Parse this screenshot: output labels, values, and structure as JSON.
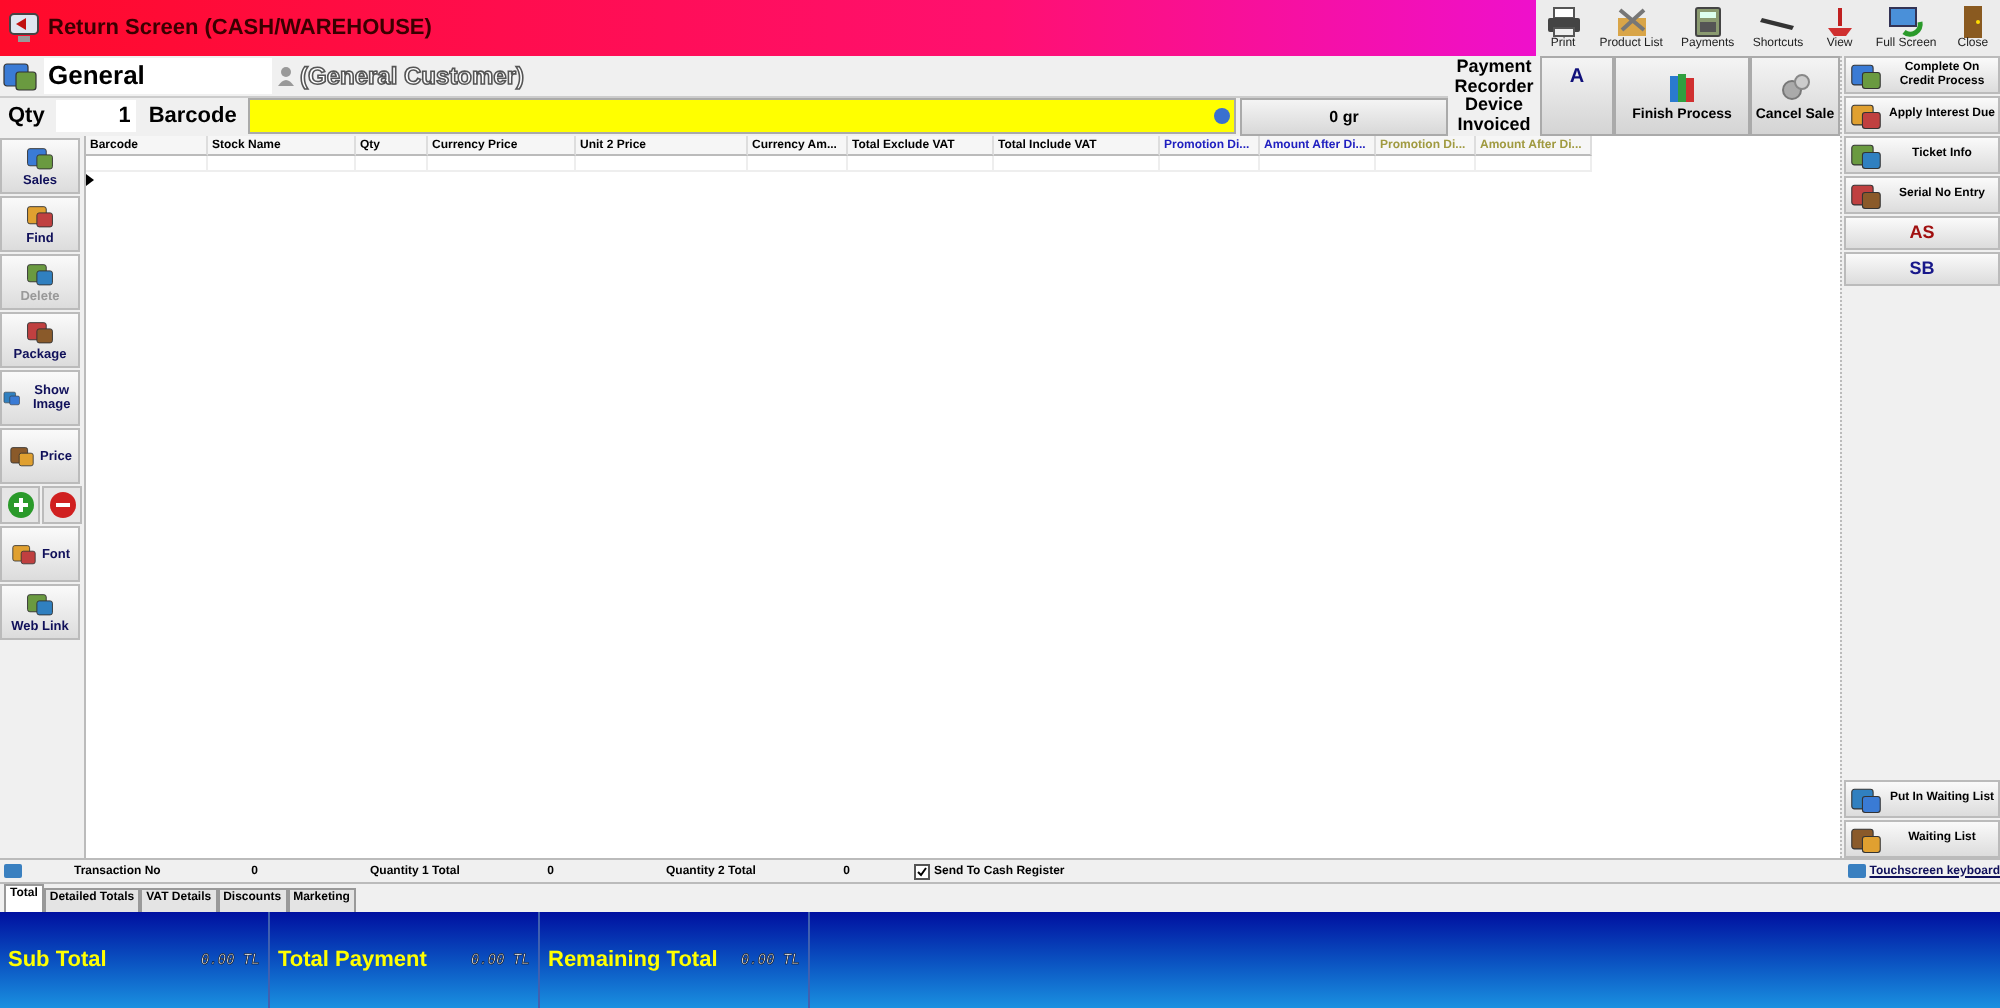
{
  "window": {
    "title": "Return Screen (CASH/WAREHOUSE)"
  },
  "toolbar": [
    {
      "label": "Print"
    },
    {
      "label": "Product List"
    },
    {
      "label": "Payments"
    },
    {
      "label": "Shortcuts"
    },
    {
      "label": "View"
    },
    {
      "label": "Full Screen"
    },
    {
      "label": "Close"
    }
  ],
  "customer": {
    "code": "General",
    "name": "(General Customer)"
  },
  "entry": {
    "qty_label": "Qty",
    "qty": "1",
    "barcode_label": "Barcode",
    "weight": "0 gr"
  },
  "payment_recorder": "Payment Recorder Device Invoiced",
  "actions": [
    {
      "label": "A",
      "kind": "text"
    },
    {
      "label": "Finish Process",
      "kind": "icon"
    },
    {
      "label": "Cancel Sale",
      "kind": "icon"
    }
  ],
  "sidebar": [
    {
      "label": "Sales",
      "kind": "stack",
      "disabled": false
    },
    {
      "label": "Find",
      "kind": "stack",
      "disabled": false
    },
    {
      "label": "Delete",
      "kind": "stack",
      "disabled": true
    },
    {
      "label": "Package",
      "kind": "stack",
      "disabled": false
    },
    {
      "label": "Show Image",
      "kind": "inline",
      "disabled": false
    },
    {
      "label": "Price",
      "kind": "inline",
      "disabled": false
    },
    {
      "kind": "pair"
    },
    {
      "label": "Font",
      "kind": "inline",
      "disabled": false
    },
    {
      "label": "Web Link",
      "kind": "stack",
      "disabled": false
    }
  ],
  "table": {
    "columns": [
      {
        "label": "Barcode",
        "color": "#000000"
      },
      {
        "label": "Stock Name",
        "color": "#000000"
      },
      {
        "label": "Qty",
        "color": "#000000"
      },
      {
        "label": "Currency Price",
        "color": "#000000"
      },
      {
        "label": "Unit 2 Price",
        "color": "#000000"
      },
      {
        "label": "Currency Am...",
        "color": "#000000"
      },
      {
        "label": "Total Exclude VAT",
        "color": "#000000"
      },
      {
        "label": "Total Include VAT",
        "color": "#000000"
      },
      {
        "label": "Promotion Di...",
        "color": "#2020c0"
      },
      {
        "label": "Amount After Di...",
        "color": "#2020c0"
      },
      {
        "label": "Promotion Di...",
        "color": "#a09a40"
      },
      {
        "label": "Amount After Di...",
        "color": "#a09a40"
      }
    ]
  },
  "right_panel": {
    "top": [
      {
        "label": "Complete On Credit Process",
        "kind": "icon"
      },
      {
        "label": "Apply Interest Due",
        "kind": "icon"
      },
      {
        "label": "Ticket Info",
        "kind": "icon"
      },
      {
        "label": "Serial No Entry",
        "kind": "icon"
      },
      {
        "label": "AS",
        "kind": "text",
        "color": "#a01010"
      },
      {
        "label": "SB",
        "kind": "text",
        "color": "#18188a"
      }
    ],
    "bottom": [
      {
        "label": "Put In Waiting List"
      },
      {
        "label": "Waiting List"
      }
    ]
  },
  "status_bar": {
    "items": [
      {
        "label": "Transaction No",
        "value": "0"
      },
      {
        "label": "Quantity 1 Total",
        "value": "0"
      },
      {
        "label": "Quantity 2 Total",
        "value": "0"
      }
    ],
    "send_to_register": {
      "label": "Send To Cash Register",
      "checked": true
    },
    "keyboard": "Touchscreen keyboard"
  },
  "tabs": [
    {
      "label": "Total",
      "selected": true
    },
    {
      "label": "Detailed Totals",
      "selected": false
    },
    {
      "label": "VAT Details",
      "selected": false
    },
    {
      "label": "Discounts",
      "selected": false
    },
    {
      "label": "Marketing",
      "selected": false
    }
  ],
  "totals": [
    {
      "label": "Sub Total",
      "value": "0.00 TL"
    },
    {
      "label": "Total Payment",
      "value": "0.00 TL"
    },
    {
      "label": "Remaining Total",
      "value": "0.00 TL"
    }
  ]
}
